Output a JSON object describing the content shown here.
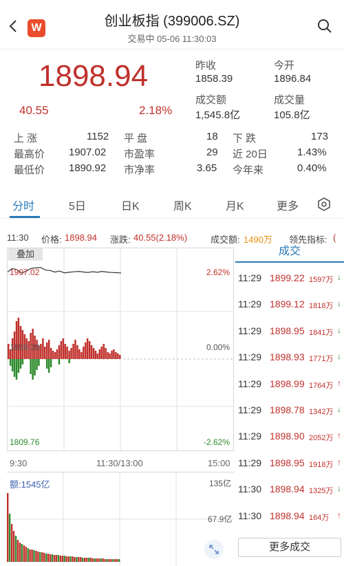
{
  "header": {
    "title": "创业板指 (399006.SZ)",
    "subtitle": "交易中 05-06 11:30:03",
    "logo_text": "W"
  },
  "quote": {
    "price": "1898.94",
    "change": "40.55",
    "change_pct": "2.18%",
    "prev_close_label": "昨收",
    "prev_close": "1858.39",
    "open_label": "今开",
    "open": "1896.84",
    "turnover_label": "成交额",
    "turnover": "1,545.8亿",
    "volume_label": "成交量",
    "volume": "105.8亿"
  },
  "stats": [
    {
      "l1": "上  涨",
      "v1": "1152",
      "l2": "平  盘",
      "v2": "18",
      "l3": "下  跌",
      "v3": "173"
    },
    {
      "l1": "最高价",
      "v1": "1907.02",
      "l2": "市盈率",
      "v2": "29",
      "l3": "近 20日",
      "v3": "1.43%"
    },
    {
      "l1": "最低价",
      "v1": "1890.92",
      "l2": "市净率",
      "v2": "3.65",
      "l3": "今年来",
      "v3": "0.40%"
    }
  ],
  "tabs": [
    "分时",
    "5日",
    "日K",
    "周K",
    "月K",
    "更多"
  ],
  "info_bar": {
    "time": "11:30",
    "price_label": "价格:",
    "price": "1898.94",
    "chg_label": "涨跌:",
    "chg": "40.55(2.18%)",
    "amt_label": "成交额:",
    "amt": "1490万",
    "lead_label": "领先指标:",
    "lead": "("
  },
  "chart": {
    "overlay_label": "叠加",
    "high": "1907.02",
    "mid": "1858.39",
    "low": "1809.76",
    "up_pct": "2.62%",
    "zero_pct": "0.00%",
    "down_pct": "-2.62%",
    "t_start": "9:30",
    "t_mid": "11:30/13:00",
    "t_end": "15:00",
    "amount_label": "额:1545亿",
    "vol_top": "135亿",
    "vol_mid": "67.9亿"
  },
  "chart_data": {
    "type": "line",
    "x": [
      "9:30",
      "9:35",
      "9:40",
      "9:45",
      "9:50",
      "9:55",
      "10:00",
      "10:05",
      "10:10",
      "10:15",
      "10:20",
      "10:25",
      "10:30",
      "10:35",
      "10:40",
      "10:45",
      "10:50",
      "10:55",
      "11:00",
      "11:05",
      "11:10",
      "11:15",
      "11:20",
      "11:25",
      "11:30"
    ],
    "series": [
      {
        "values": [
          1900.2,
          1905.6,
          1903.8,
          1898.5,
          1901.9,
          1905.8,
          1906.5,
          1907.0,
          1903.2,
          1902.5,
          1900.1,
          1901.7,
          1899.0,
          1899.8,
          1900.5,
          1901.2,
          1900.2,
          1899.6,
          1900.6,
          1899.8,
          1901.2,
          1900.1,
          1899.5,
          1899.2,
          1898.9
        ]
      }
    ],
    "ylim": [
      1809.76,
      1907.02
    ],
    "colors": {
      "up": "#c0302b",
      "down": "#2e8b2e",
      "line": "#333333"
    }
  },
  "trades": {
    "header": "成交",
    "rows": [
      {
        "t": "11:29",
        "p": "1899.22",
        "v": "1597万",
        "dir": "down"
      },
      {
        "t": "11:29",
        "p": "1899.12",
        "v": "1818万",
        "dir": "down"
      },
      {
        "t": "11:29",
        "p": "1898.95",
        "v": "1841万",
        "dir": "down"
      },
      {
        "t": "11:29",
        "p": "1898.93",
        "v": "1771万",
        "dir": "down"
      },
      {
        "t": "11:29",
        "p": "1898.99",
        "v": "1764万",
        "dir": "up"
      },
      {
        "t": "11:29",
        "p": "1898.78",
        "v": "1342万",
        "dir": "down"
      },
      {
        "t": "11:29",
        "p": "1898.90",
        "v": "2052万",
        "dir": "up"
      },
      {
        "t": "11:29",
        "p": "1898.95",
        "v": "1918万",
        "dir": "up"
      },
      {
        "t": "11:30",
        "p": "1898.94",
        "v": "1325万",
        "dir": "down"
      },
      {
        "t": "11:30",
        "p": "1898.94",
        "v": "164万",
        "dir": "up"
      }
    ],
    "more_label": "更多成交"
  },
  "icons": [
    "back-icon",
    "logo-icon",
    "search-icon",
    "settings-icon",
    "expand-icon"
  ]
}
